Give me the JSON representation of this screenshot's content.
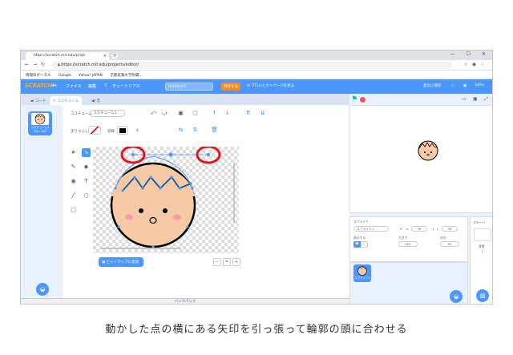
{
  "browser": {
    "tab_title": "https://scratch.mit.edu/proje",
    "new_tab": "+",
    "url": "https://scratch.mit.edu/projects/editor/",
    "window_controls": "— ☐ ✕",
    "bookmarks": [
      "情報科ポータル",
      "Google",
      "Yahoo! JAPAN",
      "京都産業大学附属…"
    ]
  },
  "menu": {
    "logo": "SCRATCH",
    "file": "ファイル",
    "edit": "編集",
    "tutorials": "チュートリアル",
    "project_title": "Untitled-5",
    "share": "共有する",
    "project_page": "プロジェクトページを見る",
    "save_now": "直ちに保存",
    "username": "kohu"
  },
  "tabs": {
    "code": "コード",
    "costumes": "コスチューム",
    "sounds": "音"
  },
  "costume_list": [
    {
      "index": "1",
      "name": "コスチューム1",
      "size": "96 x 100"
    }
  ],
  "paint_editor": {
    "costume_label": "コスチューム",
    "costume_name": "コスチューム1",
    "fill_label": "塗りつぶし",
    "outline_label": "枠線",
    "outline_size": "4",
    "convert_button": "ビットマップに変換",
    "zoom_out": "−",
    "zoom_reset": "=",
    "zoom_in": "+",
    "accent_color": "#4c97ff",
    "highlight_color": "#e2141e"
  },
  "sprite_info": {
    "sprite_label": "スプライト",
    "sprite_name": "スプライト1",
    "x_label": "x",
    "x_value": "36",
    "y_label": "y",
    "y_value": "36",
    "show_label": "表示する",
    "size_label": "大きさ",
    "size_value": "100",
    "direction_label": "向き",
    "direction_value": "90",
    "sprite_thumb_label": "スプライト1"
  },
  "stage_panel": {
    "label": "ステージ",
    "backdrops_label": "背景",
    "backdrops_count": "1"
  },
  "backpack": "バックパック",
  "caption": "動かした点の横にある矢印を引っ張って輪郭の頭に合わせる"
}
